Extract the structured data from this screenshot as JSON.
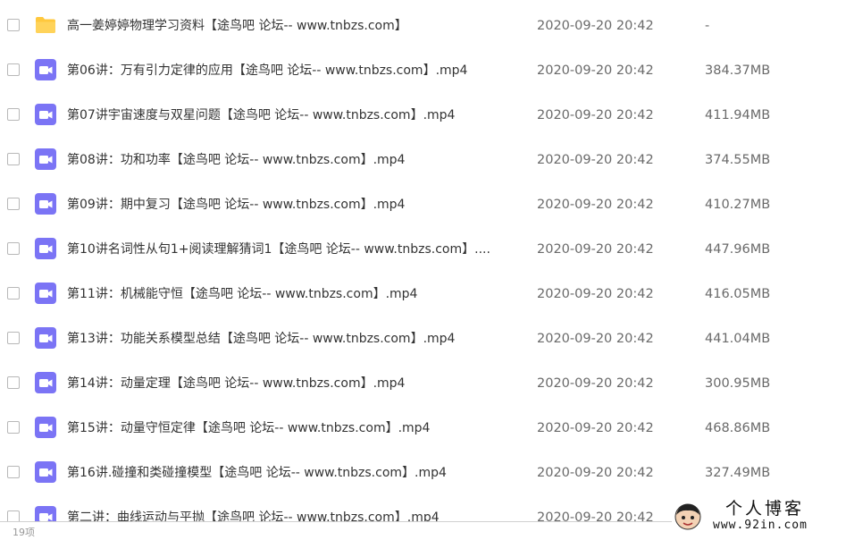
{
  "files": [
    {
      "type": "folder",
      "name": "高一姜婷婷物理学习资料【途鸟吧 论坛-- www.tnbzs.com】",
      "date": "2020-09-20 20:42",
      "size": "-"
    },
    {
      "type": "video",
      "name": "第06讲：万有引力定律的应用【途鸟吧 论坛-- www.tnbzs.com】.mp4",
      "date": "2020-09-20 20:42",
      "size": "384.37MB"
    },
    {
      "type": "video",
      "name": "第07讲宇宙速度与双星问题【途鸟吧 论坛-- www.tnbzs.com】.mp4",
      "date": "2020-09-20 20:42",
      "size": "411.94MB"
    },
    {
      "type": "video",
      "name": "第08讲：功和功率【途鸟吧 论坛-- www.tnbzs.com】.mp4",
      "date": "2020-09-20 20:42",
      "size": "374.55MB"
    },
    {
      "type": "video",
      "name": "第09讲：期中复习【途鸟吧 论坛-- www.tnbzs.com】.mp4",
      "date": "2020-09-20 20:42",
      "size": "410.27MB"
    },
    {
      "type": "video",
      "name": "第10讲名词性从句1+阅读理解猜词1【途鸟吧 论坛-- www.tnbzs.com】....",
      "date": "2020-09-20 20:42",
      "size": "447.96MB"
    },
    {
      "type": "video",
      "name": "第11讲：机械能守恒【途鸟吧 论坛-- www.tnbzs.com】.mp4",
      "date": "2020-09-20 20:42",
      "size": "416.05MB"
    },
    {
      "type": "video",
      "name": "第13讲：功能关系模型总结【途鸟吧 论坛-- www.tnbzs.com】.mp4",
      "date": "2020-09-20 20:42",
      "size": "441.04MB"
    },
    {
      "type": "video",
      "name": "第14讲：动量定理【途鸟吧 论坛-- www.tnbzs.com】.mp4",
      "date": "2020-09-20 20:42",
      "size": "300.95MB"
    },
    {
      "type": "video",
      "name": "第15讲：动量守恒定律【途鸟吧 论坛-- www.tnbzs.com】.mp4",
      "date": "2020-09-20 20:42",
      "size": "468.86MB"
    },
    {
      "type": "video",
      "name": "第16讲.碰撞和类碰撞模型【途鸟吧 论坛-- www.tnbzs.com】.mp4",
      "date": "2020-09-20 20:42",
      "size": "327.49MB"
    },
    {
      "type": "video",
      "name": "第二讲：曲线运动与平抛【途鸟吧 论坛-- www.tnbzs.com】.mp4",
      "date": "2020-09-20 20:42",
      "size": ""
    }
  ],
  "footer": {
    "item_count": "19项"
  },
  "watermark": {
    "title": "个人博客",
    "url": "www.92in.com"
  },
  "colors": {
    "folder": "#ffc83d",
    "video": "#7b74f5",
    "divider": "#d0d0d0"
  },
  "icons": {
    "folder": "folder-icon",
    "video": "video-file-icon",
    "checkbox": "checkbox-icon"
  }
}
